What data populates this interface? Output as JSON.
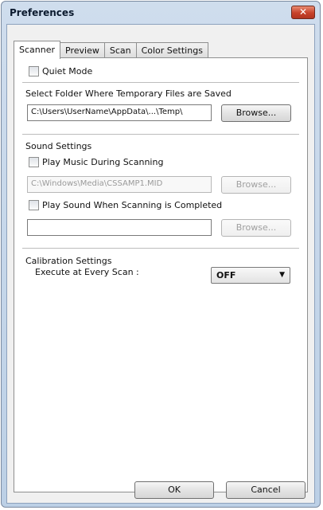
{
  "window": {
    "title": "Preferences",
    "close_glyph": "✕"
  },
  "tabs": [
    {
      "label": "Scanner",
      "active": true
    },
    {
      "label": "Preview",
      "active": false
    },
    {
      "label": "Scan",
      "active": false
    },
    {
      "label": "Color Settings",
      "active": false
    }
  ],
  "quiet_mode": {
    "label": "Quiet Mode",
    "checked": false
  },
  "temp_folder": {
    "heading": "Select Folder Where Temporary Files are Saved",
    "path": "C:\\Users\\UserName\\AppData\\...\\Temp\\",
    "browse_label": "Browse..."
  },
  "sound": {
    "heading": "Sound Settings",
    "play_music_label": "Play Music During Scanning",
    "music_path": "C:\\Windows\\Media\\CSSAMP1.MID",
    "music_browse_label": "Browse...",
    "play_sound_label": "Play Sound When Scanning is Completed",
    "sound_path": "",
    "sound_browse_label": "Browse..."
  },
  "calibration": {
    "heading": "Calibration Settings",
    "execute_label": "Execute at Every Scan :",
    "value": "OFF",
    "arrow_glyph": "▼"
  },
  "footer": {
    "ok_label": "OK",
    "cancel_label": "Cancel"
  }
}
